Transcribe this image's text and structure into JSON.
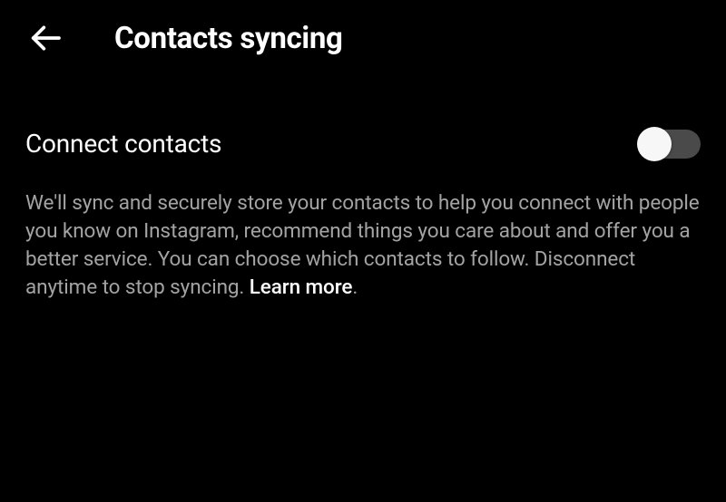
{
  "header": {
    "title": "Contacts syncing"
  },
  "settings": {
    "connect_contacts": {
      "label": "Connect contacts",
      "enabled": false,
      "description": "We'll sync and securely store your contacts to help you connect with people you know on Instagram, recommend things you care about and offer you a better service. You can choose which contacts to follow. Disconnect anytime to stop syncing. ",
      "learn_more_label": "Learn more"
    }
  }
}
